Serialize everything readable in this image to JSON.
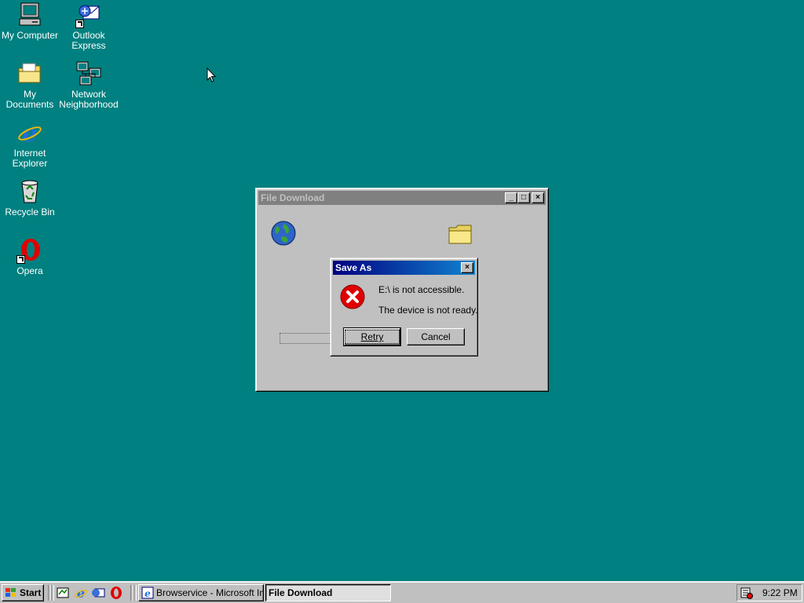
{
  "desktop": {
    "icons": [
      {
        "label": "My Computer",
        "icon": "my-computer-icon"
      },
      {
        "label": "Outlook Express",
        "icon": "outlook-express-icon"
      },
      {
        "label": "My Documents",
        "icon": "my-documents-icon"
      },
      {
        "label": "Network Neighborhood",
        "icon": "network-neighborhood-icon"
      },
      {
        "label": "Internet Explorer",
        "icon": "internet-explorer-icon"
      },
      {
        "label": "Recycle Bin",
        "icon": "recycle-bin-icon"
      },
      {
        "label": "Opera",
        "icon": "opera-icon"
      }
    ],
    "background_color": "#008080"
  },
  "file_download_window": {
    "title": "File Download",
    "buttons": {
      "minimize": "_",
      "maximize": "□",
      "close": "×"
    }
  },
  "save_as_dialog": {
    "title": "Save As",
    "message_line1": "E:\\ is not accessible.",
    "message_line2": "The device is not ready.",
    "retry_label": "Retry",
    "cancel_label": "Cancel",
    "close_label": "×",
    "icon": "error-icon"
  },
  "taskbar": {
    "start_label": "Start",
    "tasks": [
      {
        "label": "Browservice - Microsoft Int...",
        "active": false
      },
      {
        "label": "File Download",
        "active": true
      }
    ],
    "clock": "9:22 PM"
  }
}
